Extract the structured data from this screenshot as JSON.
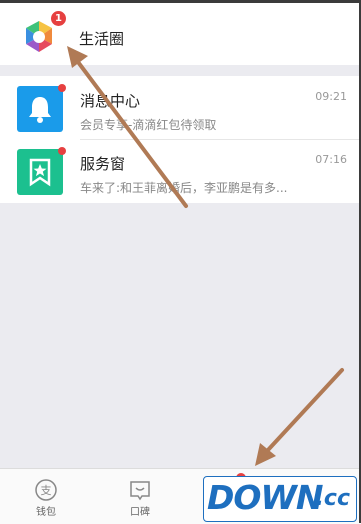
{
  "header": {
    "title": "生活圈",
    "badge": "1"
  },
  "messages": [
    {
      "title": "消息中心",
      "subtitle": "会员专享-滴滴红包待领取",
      "time": "09:21",
      "icon": "bell-icon",
      "color": "#1a9bea"
    },
    {
      "title": "服务窗",
      "subtitle": "车来了:和王菲离婚后，李亚鹏是有多...",
      "time": "07:16",
      "icon": "bookmark-star-icon",
      "color": "#1cc08f"
    }
  ],
  "tabbar": [
    {
      "label": "钱包",
      "icon": "alipay-wallet-icon"
    },
    {
      "label": "口碑",
      "icon": "koubei-icon"
    }
  ],
  "watermark": {
    "main": "DOWN",
    "suffix": ".cc"
  },
  "colors": {
    "badge": "#e64040",
    "annotation_arrow": "#b07a55",
    "watermark": "#1e6fbf"
  }
}
